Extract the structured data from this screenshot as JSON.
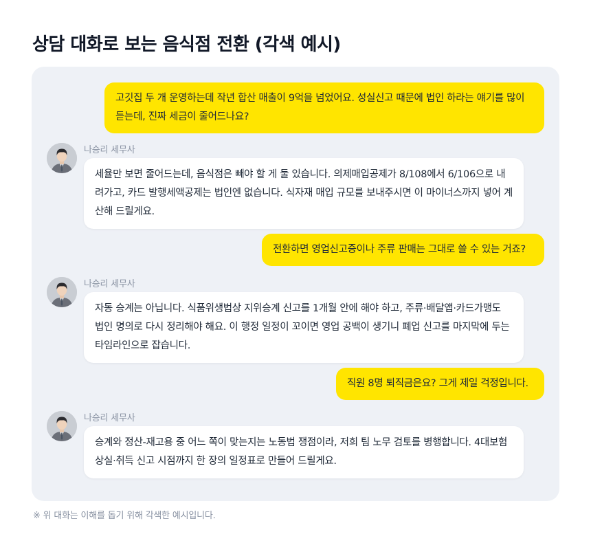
{
  "page": {
    "title": "상담 대화로 보는 음식점 전환 (각색 예시)",
    "footnote": "※ 위 대화는 이해를 돕기 위해 각색한 예시입니다."
  },
  "messages": [
    {
      "role": "user",
      "text": "고깃집 두 개 운영하는데 작년 합산 매출이 9억을 넘었어요. 성실신고 때문에 법인 하라는 얘기를 많이 듣는데, 진짜 세금이 줄어드나요?"
    },
    {
      "role": "advisor",
      "name": "나승리 세무사",
      "text": "세율만 보면 줄어드는데, 음식점은 빼야 할 게 둘 있습니다. 의제매입공제가 8/108에서 6/106으로 내려가고, 카드 발행세액공제는 법인엔 없습니다. 식자재 매입 규모를 보내주시면 이 마이너스까지 넣어 계산해 드릴게요."
    },
    {
      "role": "user",
      "text": "전환하면 영업신고증이나 주류 판매는 그대로 쓸 수 있는 거죠?"
    },
    {
      "role": "advisor",
      "name": "나승리 세무사",
      "text": "자동 승계는 아닙니다. 식품위생법상 지위승계 신고를 1개월 안에 해야 하고, 주류·배달앱·카드가맹도 법인 명의로 다시 정리해야 해요. 이 행정 일정이 꼬이면 영업 공백이 생기니 폐업 신고를 마지막에 두는 타임라인으로 잡습니다."
    },
    {
      "role": "user",
      "text": "직원 8명 퇴직금은요? 그게 제일 걱정입니다."
    },
    {
      "role": "advisor",
      "name": "나승리 세무사",
      "text": "승계와 정산-재고용 중 어느 쪽이 맞는지는 노동법 쟁점이라, 저희 팀 노무 검토를 병행합니다. 4대보험 상실·취득 신고 시점까지 한 장의 일정표로 만들어 드릴게요."
    }
  ],
  "colors": {
    "user_bubble": "#ffe500",
    "advisor_bubble": "#ffffff",
    "panel_background": "#eef1f6",
    "title": "#111827",
    "muted_text": "#8a93a3"
  },
  "icons": {
    "avatar": "advisor-portrait-icon"
  }
}
